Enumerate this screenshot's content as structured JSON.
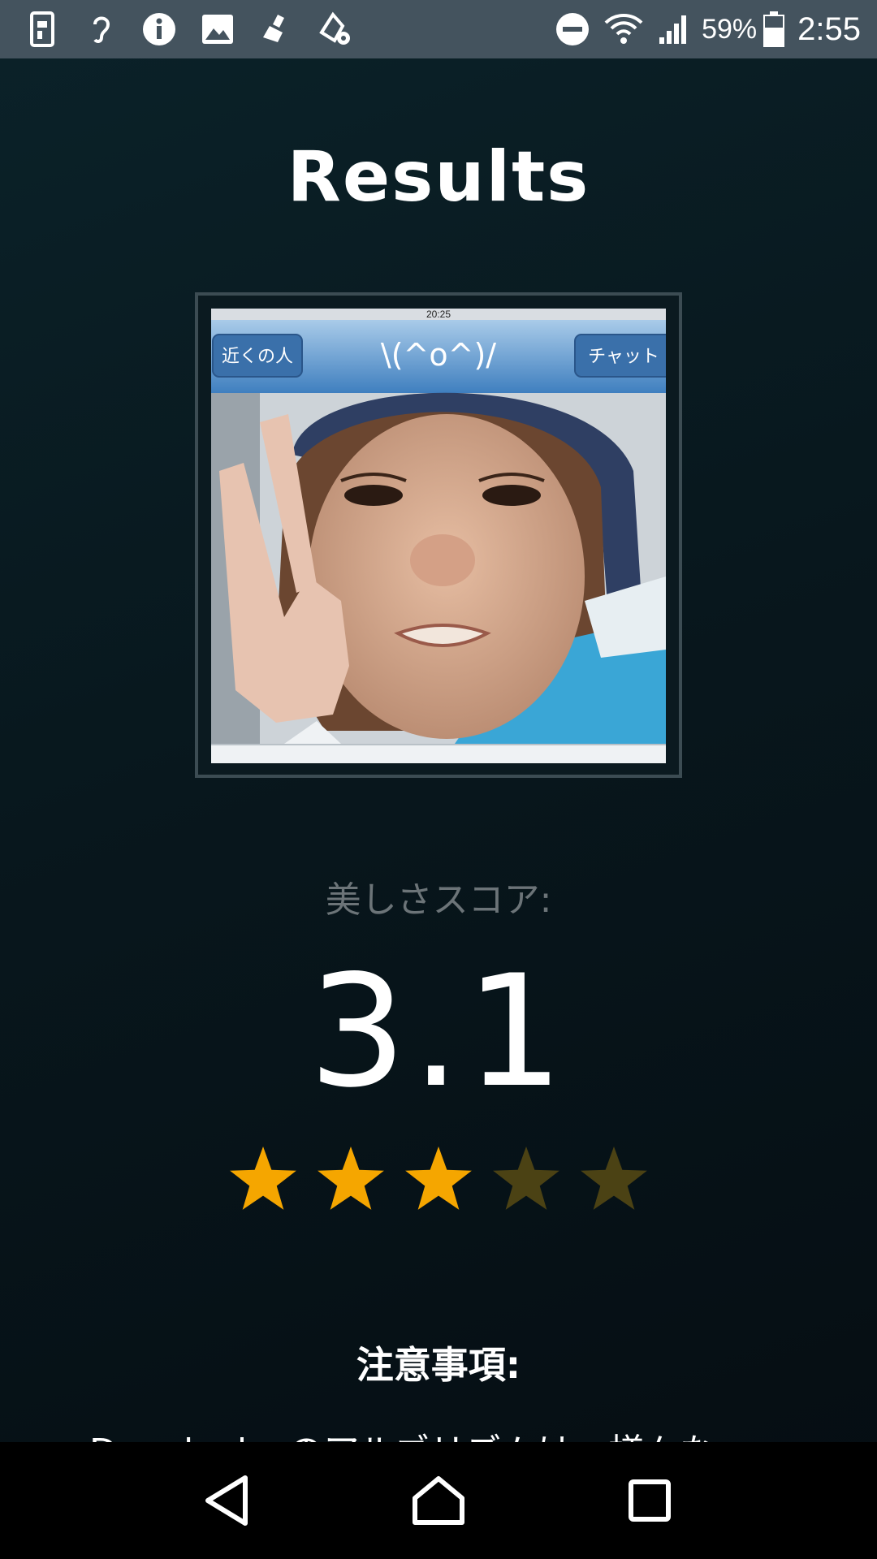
{
  "status_bar": {
    "left_icons": [
      "sim-card-icon",
      "hearing-icon",
      "info-icon",
      "image-icon",
      "sweep-icon",
      "paint-settings-icon"
    ],
    "right_icons": [
      "do-not-disturb-icon",
      "wifi-icon",
      "signal-icon"
    ],
    "battery_percent": "59%",
    "time": "2:55"
  },
  "page": {
    "title": "Results",
    "photo": {
      "app_left_button": "近くの人",
      "app_title": "\\(^o^)/",
      "app_right_button": "チャット",
      "app_status_time": "20:25"
    },
    "score_label": "美しさスコア:",
    "score_value": "3.1",
    "rating": {
      "filled": 3,
      "total": 5,
      "filled_color": "#f5a600",
      "empty_color": "#4b4214"
    },
    "notes_heading": "注意事項:",
    "notes_text": "Deeplooks のアルゴリズムは、様々な"
  },
  "nav_bar": {
    "buttons": [
      "back-icon",
      "home-icon",
      "recents-icon"
    ]
  }
}
